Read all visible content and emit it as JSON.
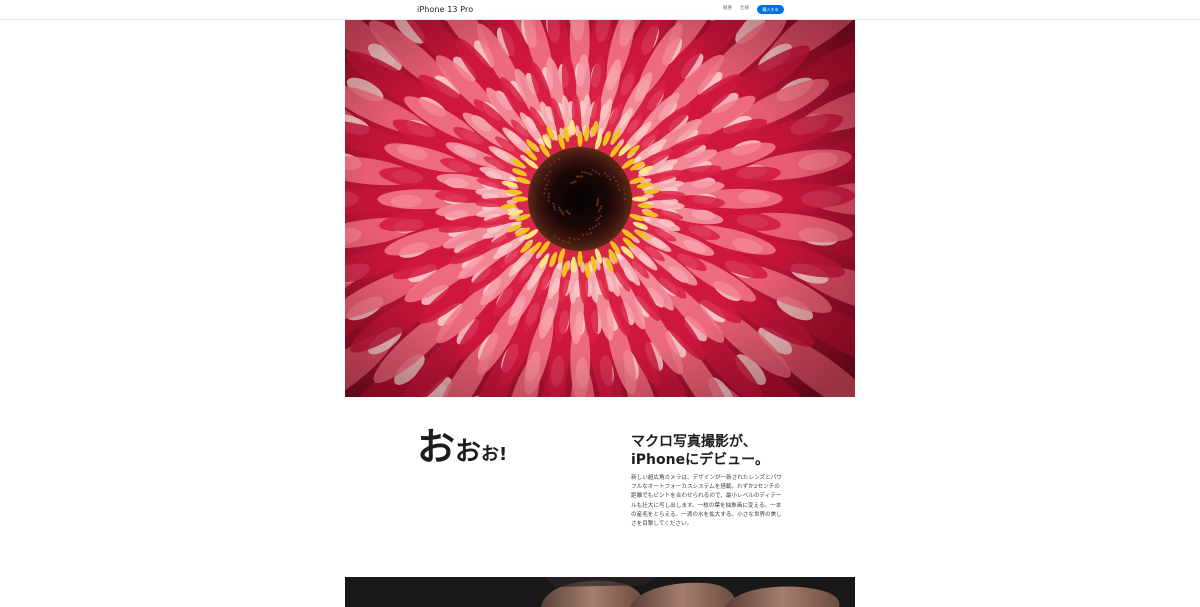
{
  "localnav": {
    "title": "iPhone 13 Pro",
    "links": [
      "概要",
      "仕様"
    ],
    "buy_label": "購入する",
    "accent_color": "#0071e3"
  },
  "hero": {
    "image_subject": "red gerbera flower macro photo"
  },
  "section": {
    "wow": {
      "big": "お",
      "mid": "お",
      "small": "お",
      "bang": "!"
    },
    "headline_lines": [
      "マクロ写真撮影が、",
      "iPhoneにデビュー。"
    ],
    "body": "新しい超広角カメラは、デザインが一新されたレンズとパワフルなオートフォーカスシステムを搭載。わずか2センチの距離でもピントを合わせられるので、最小レベルのディテールも壮大に写し出します。一枚の葉を抽象画に変える。一本の産毛をとらえる。一滴の水を拡大する。小さな世界の美しさを目撃してください。"
  },
  "bottom": {
    "image_subject": "dark photo of fingers"
  }
}
